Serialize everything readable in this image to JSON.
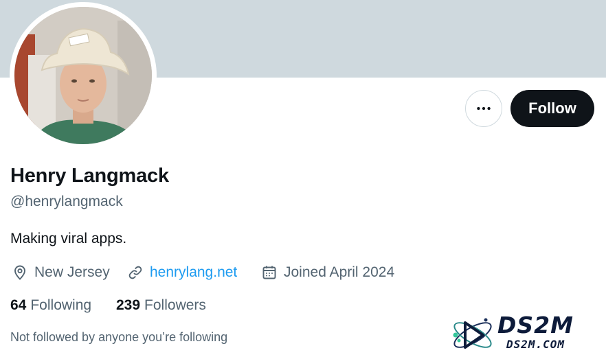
{
  "profile": {
    "name": "Henry Langmack",
    "handle": "@henrylangmack",
    "bio": "Making viral apps.",
    "location": "New Jersey",
    "website": "henrylang.net",
    "joined": "Joined April 2024"
  },
  "stats": {
    "following_count": "64",
    "following_label": "Following",
    "followers_count": "239",
    "followers_label": "Followers"
  },
  "social_context": "Not followed by anyone you’re following",
  "actions": {
    "follow_label": "Follow",
    "more_icon": "more-horizontal-icon"
  },
  "icons": {
    "location": "location-pin-icon",
    "link": "link-icon",
    "calendar": "calendar-icon"
  },
  "colors": {
    "banner": "#cfd9de",
    "text_primary": "#0f1419",
    "text_secondary": "#536471",
    "link": "#1d9bf0",
    "follow_button_bg": "#0f1419"
  },
  "watermark": {
    "title": "DS2M",
    "subtitle": "DS2M.COM"
  }
}
